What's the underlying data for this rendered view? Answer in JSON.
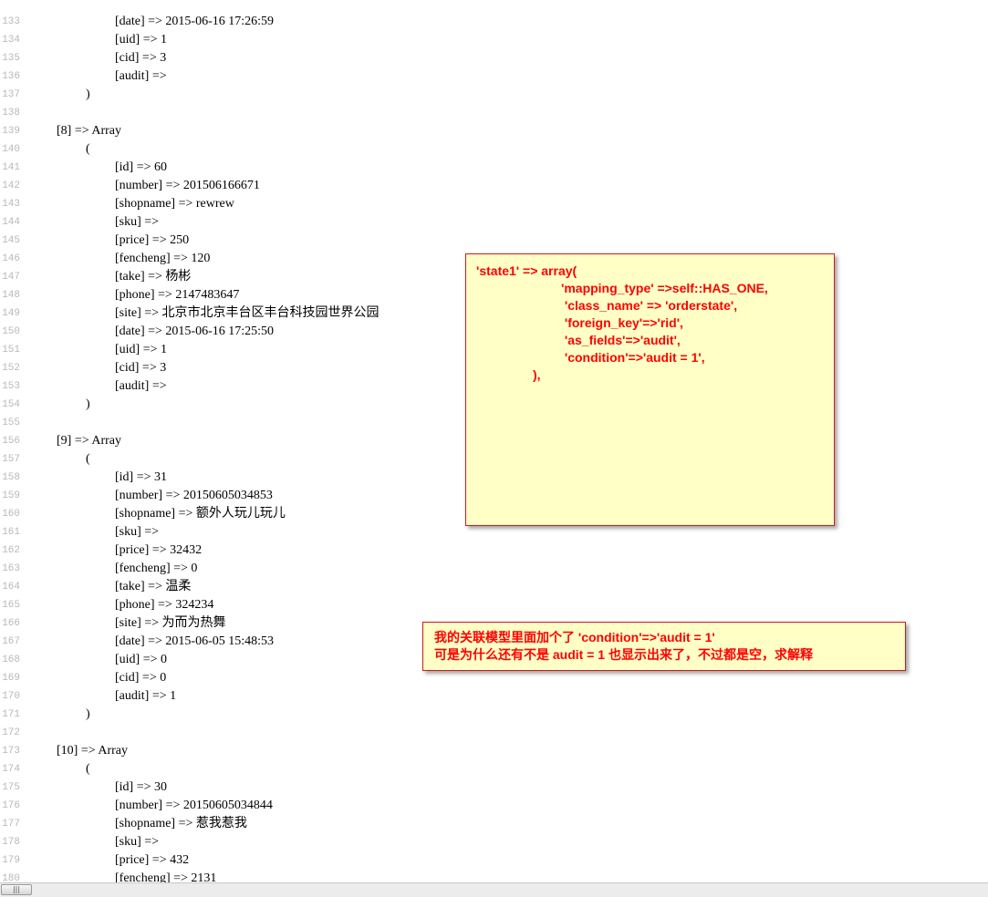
{
  "code_lines": [
    {
      "num": "133",
      "indent": 1,
      "text": "[date] => 2015-06-16 17:26:59"
    },
    {
      "num": "134",
      "indent": 1,
      "text": "[uid] => 1"
    },
    {
      "num": "135",
      "indent": 1,
      "text": "[cid] => 3"
    },
    {
      "num": "136",
      "indent": 1,
      "text": "[audit] =>"
    },
    {
      "num": "137",
      "indent": 0.5,
      "text": ")"
    },
    {
      "num": "138",
      "indent": 0,
      "text": ""
    },
    {
      "num": "139",
      "indent": 0,
      "text": "[8] => Array"
    },
    {
      "num": "140",
      "indent": 0.5,
      "text": "("
    },
    {
      "num": "141",
      "indent": 1,
      "text": "[id] => 60"
    },
    {
      "num": "142",
      "indent": 1,
      "text": "[number] => 201506166671"
    },
    {
      "num": "143",
      "indent": 1,
      "text": "[shopname] => rewrew"
    },
    {
      "num": "144",
      "indent": 1,
      "text": "[sku] =>"
    },
    {
      "num": "145",
      "indent": 1,
      "text": "[price] => 250"
    },
    {
      "num": "146",
      "indent": 1,
      "text": "[fencheng] => 120"
    },
    {
      "num": "147",
      "indent": 1,
      "text": "[take] => 杨彬"
    },
    {
      "num": "148",
      "indent": 1,
      "text": "[phone] => 2147483647"
    },
    {
      "num": "149",
      "indent": 1,
      "text": "[site] => 北京市北京丰台区丰台科技园世界公园"
    },
    {
      "num": "150",
      "indent": 1,
      "text": "[date] => 2015-06-16 17:25:50"
    },
    {
      "num": "151",
      "indent": 1,
      "text": "[uid] => 1"
    },
    {
      "num": "152",
      "indent": 1,
      "text": "[cid] => 3"
    },
    {
      "num": "153",
      "indent": 1,
      "text": "[audit] =>"
    },
    {
      "num": "154",
      "indent": 0.5,
      "text": ")"
    },
    {
      "num": "155",
      "indent": 0,
      "text": ""
    },
    {
      "num": "156",
      "indent": 0,
      "text": "[9] => Array"
    },
    {
      "num": "157",
      "indent": 0.5,
      "text": "("
    },
    {
      "num": "158",
      "indent": 1,
      "text": "[id] => 31"
    },
    {
      "num": "159",
      "indent": 1,
      "text": "[number] => 20150605034853"
    },
    {
      "num": "160",
      "indent": 1,
      "text": "[shopname] => 额外人玩儿玩儿"
    },
    {
      "num": "161",
      "indent": 1,
      "text": "[sku] =>"
    },
    {
      "num": "162",
      "indent": 1,
      "text": "[price] => 32432"
    },
    {
      "num": "163",
      "indent": 1,
      "text": "[fencheng] => 0"
    },
    {
      "num": "164",
      "indent": 1,
      "text": "[take] => 温柔"
    },
    {
      "num": "165",
      "indent": 1,
      "text": "[phone] => 324234"
    },
    {
      "num": "166",
      "indent": 1,
      "text": "[site] => 为而为热舞"
    },
    {
      "num": "167",
      "indent": 1,
      "text": "[date] => 2015-06-05 15:48:53"
    },
    {
      "num": "168",
      "indent": 1,
      "text": "[uid] => 0"
    },
    {
      "num": "169",
      "indent": 1,
      "text": "[cid] => 0"
    },
    {
      "num": "170",
      "indent": 1,
      "text": "[audit] => 1"
    },
    {
      "num": "171",
      "indent": 0.5,
      "text": ")"
    },
    {
      "num": "172",
      "indent": 0,
      "text": ""
    },
    {
      "num": "173",
      "indent": 0,
      "text": "[10] => Array"
    },
    {
      "num": "174",
      "indent": 0.5,
      "text": "("
    },
    {
      "num": "175",
      "indent": 1,
      "text": "[id] => 30"
    },
    {
      "num": "176",
      "indent": 1,
      "text": "[number] => 20150605034844"
    },
    {
      "num": "177",
      "indent": 1,
      "text": "[shopname] => 惹我惹我"
    },
    {
      "num": "178",
      "indent": 1,
      "text": "[sku] =>"
    },
    {
      "num": "179",
      "indent": 1,
      "text": "[price] => 432"
    },
    {
      "num": "180",
      "indent": 1,
      "text": "[fencheng] => 2131"
    }
  ],
  "annotations": {
    "code_note": {
      "lines": [
        {
          "indent": 0,
          "text": "'state1' => array("
        },
        {
          "indent": 3,
          "text": "'mapping_type' =>self::HAS_ONE,"
        },
        {
          "indent": 3,
          "text": " 'class_name' => 'orderstate',"
        },
        {
          "indent": 3,
          "text": " 'foreign_key'=>'rid',"
        },
        {
          "indent": 3,
          "text": " 'as_fields'=>'audit',"
        },
        {
          "indent": 3,
          "text": " 'condition'=>'audit = 1',"
        },
        {
          "indent": 2,
          "text": "),"
        }
      ]
    },
    "question_note": {
      "lines": [
        "我的关联模型里面加个了 'condition'=>'audit = 1'",
        "可是为什么还有不是 audit = 1 也显示出来了，不过都是空，求解释"
      ]
    }
  },
  "scrollbar": {
    "thumb_label": "|||"
  },
  "colors": {
    "note_border": "#d0181f",
    "note_background": "#ffffc6",
    "note_text": "#ff0000",
    "line_number": "#b8b8b8"
  }
}
